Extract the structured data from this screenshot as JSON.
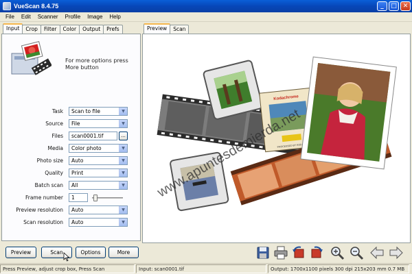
{
  "window": {
    "title": "VueScan 8.4.75",
    "minimize": "_",
    "maximize": "□",
    "close": "✕"
  },
  "menu": [
    "File",
    "Edit",
    "Scanner",
    "Profile",
    "Image",
    "Help"
  ],
  "left_tabs": [
    "Input",
    "Crop",
    "Filter",
    "Color",
    "Output",
    "Prefs"
  ],
  "promo_text": "For more options press More button",
  "fields": [
    {
      "label": "Task",
      "value": "Scan to file",
      "type": "combo"
    },
    {
      "label": "Source",
      "value": "File",
      "type": "combo"
    },
    {
      "label": "Files",
      "value": "scan0001.tif",
      "type": "file"
    },
    {
      "label": "Media",
      "value": "Color photo",
      "type": "combo"
    },
    {
      "label": "Photo size",
      "value": "Auto",
      "type": "combo"
    },
    {
      "label": "Quality",
      "value": "Print",
      "type": "combo"
    },
    {
      "label": "Batch scan",
      "value": "All",
      "type": "combo"
    },
    {
      "label": "Frame number",
      "value": "1",
      "type": "slider",
      "level": 0
    },
    {
      "label": "Preview resolution",
      "value": "Auto",
      "type": "combo"
    },
    {
      "label": "Scan resolution",
      "value": "Auto",
      "type": "combo"
    }
  ],
  "files_button": "...",
  "right_tabs": [
    "Preview",
    "Scan"
  ],
  "preview": {
    "slide_label": "Kodachrome",
    "slide_footer": "PROCESSED BY KODAK"
  },
  "watermark": "www.apuntesdemierda.net",
  "buttons": {
    "preview": "Preview",
    "scan": "Scan",
    "options": "Options",
    "more": "More"
  },
  "toolbar_icons": [
    "save-icon",
    "print-icon",
    "rotate-left-icon",
    "rotate-right-icon",
    "zoom-in-icon",
    "zoom-out-icon",
    "previous-icon",
    "next-icon"
  ],
  "status": {
    "hint": "Press Preview, adjust crop box, Press Scan",
    "input": "Input: scan0001.tif",
    "output": "Output: 1700x1100 pixels 300 dpi 215x203 mm 0.7 MB"
  },
  "colors": {
    "titlebar": "#0a4fc4",
    "tab_highlight": "#f6b64c",
    "field_border": "#7f9db9"
  }
}
